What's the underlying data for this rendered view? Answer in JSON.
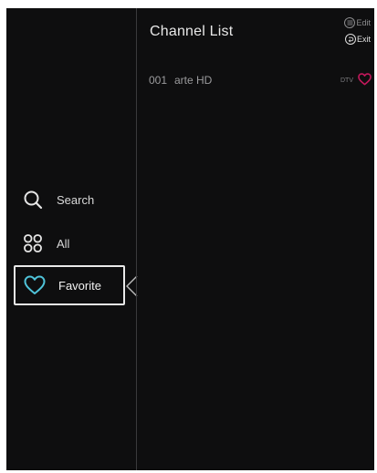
{
  "nav": {
    "search_label": "Search",
    "all_label": "All",
    "favorite_label": "Favorite"
  },
  "header": {
    "title": "Channel List",
    "edit_label": "Edit",
    "exit_label": "Exit"
  },
  "channels": [
    {
      "number": "001",
      "name": "arte HD",
      "type": "DTV",
      "favorite": true
    }
  ],
  "colors": {
    "background": "#0e0e0f",
    "favorite_accent": "#c2185b",
    "selected_icon": "#4fc3d9"
  },
  "icons": {
    "search": "search-icon",
    "all": "grid-icon",
    "favorite": "heart-icon",
    "edit": "menu-icon",
    "exit": "back-icon"
  }
}
